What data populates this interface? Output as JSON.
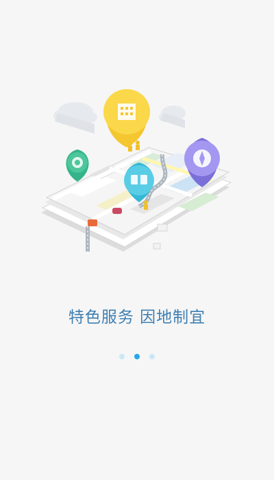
{
  "onboarding": {
    "slogan": "特色服务   因地制宜",
    "page_count": 3,
    "active_page": 2,
    "colors": {
      "background": "#f6f6f6",
      "slogan": "#3e7fb2",
      "dot_active": "#27a8e6",
      "dot_inactive": "#c9e8f7"
    },
    "illustration": {
      "pins": [
        "building-pin-icon",
        "wallet-pin-icon",
        "gift-pin-icon",
        "compass-pin-icon"
      ]
    }
  }
}
